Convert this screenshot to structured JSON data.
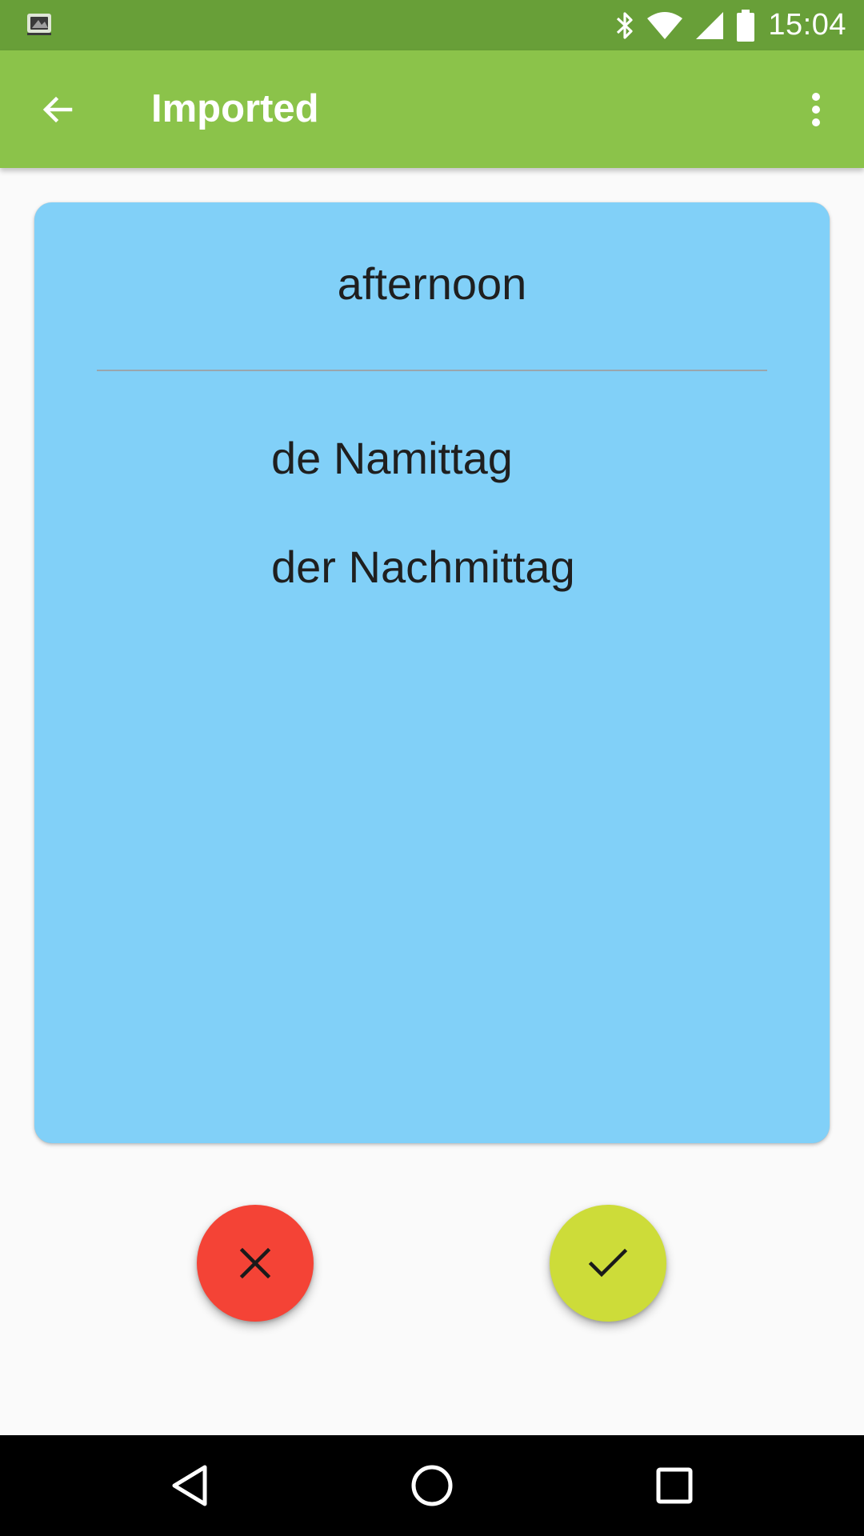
{
  "status_bar": {
    "time": "15:04",
    "icons": [
      "app-notification-icon",
      "bluetooth-icon",
      "wifi-icon",
      "cell-signal-icon",
      "battery-icon"
    ]
  },
  "app_bar": {
    "title": "Imported",
    "back_icon": "arrow-back-icon",
    "menu_icon": "more-vert-icon",
    "color": "#8bc34a"
  },
  "card": {
    "color": "#81d0f8",
    "word": "afternoon",
    "translations": [
      "de Namittag",
      "der Nachmittag"
    ]
  },
  "actions": {
    "wrong": {
      "icon": "close-icon",
      "color": "#f44336"
    },
    "right": {
      "icon": "check-icon",
      "color": "#cddc39"
    }
  },
  "nav_bar": {
    "icons": [
      "back-triangle-icon",
      "home-circle-icon",
      "recents-square-icon"
    ]
  }
}
